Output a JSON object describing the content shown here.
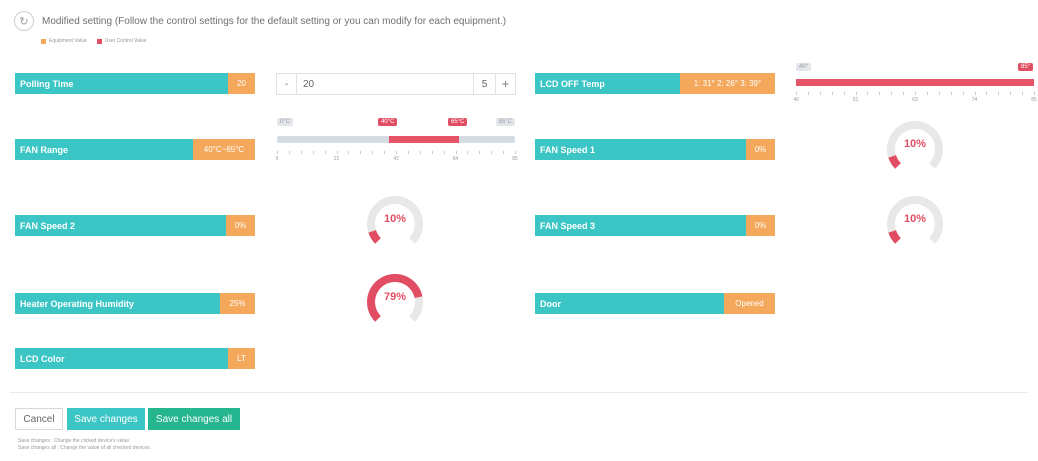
{
  "header": {
    "icon": "reset-icon",
    "icon_glyph": "↻",
    "text": "Modified setting (Follow the control settings for the default setting or you can modify for each equipment.)"
  },
  "legend": [
    {
      "label": "Equipment Value",
      "color": "#f4a85b"
    },
    {
      "label": "User Control Value",
      "color": "#e14d62"
    }
  ],
  "rows": {
    "polling_time": {
      "label": "Polling Time",
      "value": "20"
    },
    "fan_range": {
      "label": "FAN Range",
      "value": "40°C~65°C"
    },
    "fan_speed_2": {
      "label": "FAN Speed 2",
      "value": "0%"
    },
    "heater_humidity": {
      "label": "Heater Operating Humidity",
      "value": "25%"
    },
    "lcd_color": {
      "label": "LCD Color",
      "value": "LT"
    },
    "lcd_off_temp": {
      "label": "LCD OFF Temp",
      "value": "1: 31° 2: 26° 3: 39°"
    },
    "fan_speed_1": {
      "label": "FAN Speed 1",
      "value": "0%"
    },
    "fan_speed_3": {
      "label": "FAN Speed 3",
      "value": "0%"
    },
    "door": {
      "label": "Door",
      "value": "Opened"
    }
  },
  "polling_stepper": {
    "minus": "-",
    "value": "20",
    "step": "5",
    "plus": "+"
  },
  "fan_range_slider": {
    "min_label": "0°C",
    "max_label": "85°C",
    "low_label": "40°C",
    "high_label": "65°C",
    "min": 0,
    "max": 85,
    "low": 40,
    "high": 65,
    "ticks": [
      "0",
      "21",
      "43",
      "64",
      "85"
    ]
  },
  "lcd_off_slider": {
    "min_label": "40°",
    "max_label": "85°",
    "min": 40,
    "max": 85,
    "value": 85,
    "ticks": [
      "40",
      "51",
      "63",
      "74",
      "85"
    ]
  },
  "gauges": {
    "fan_speed_2": {
      "label": "10%",
      "fraction": 0.1
    },
    "heater_humidity": {
      "label": "79%",
      "fraction": 0.79
    },
    "fan_speed_1": {
      "label": "10%",
      "fraction": 0.1
    },
    "fan_speed_3": {
      "label": "10%",
      "fraction": 0.1
    }
  },
  "actions": {
    "cancel": "Cancel",
    "save": "Save changes",
    "save_all": "Save changes all"
  },
  "notes": [
    "Save changes : Change the clicked device's value.",
    "Save changes all : Change the value of all checked devices."
  ],
  "colors": {
    "teal": "#3cc5c5",
    "orange": "#f4a85b",
    "red": "#e14d62",
    "save_button": "#3cc5c5",
    "save_all_button": "#25b58f"
  }
}
